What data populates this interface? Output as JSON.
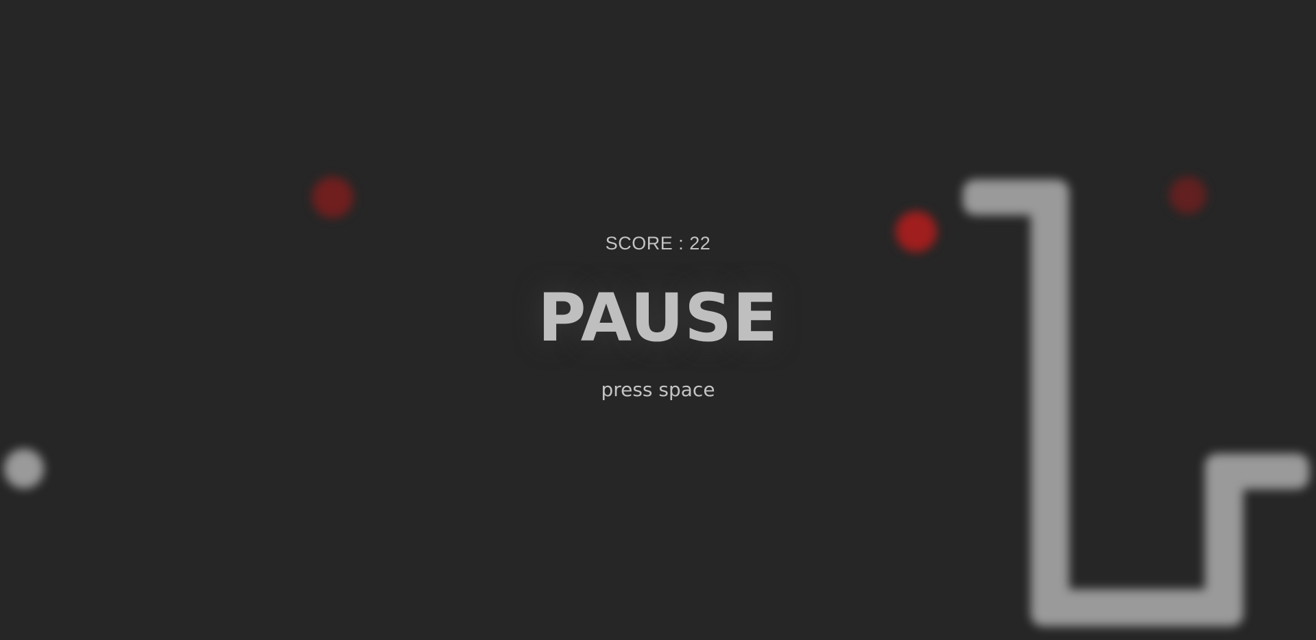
{
  "game": {
    "score_label": "SCORE",
    "score_separator": " : ",
    "score_value": "22",
    "state_title": "PAUSE",
    "hint": "press space"
  },
  "colors": {
    "background": "#262626",
    "snake": "#9a9a9a",
    "food": "#8a1c1c",
    "text": "#bfbfbf"
  }
}
